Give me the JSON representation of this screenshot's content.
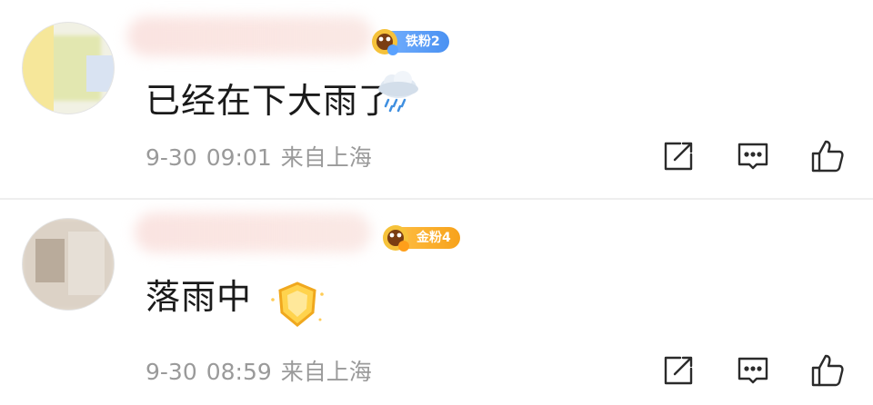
{
  "comments": [
    {
      "fan_badge": "铁粉2",
      "content": "已经在下大雨了",
      "emoji": "rain-cloud-emoji",
      "date": "9-30",
      "time": "09:01",
      "location": "来自上海"
    },
    {
      "fan_badge": "金粉4",
      "content": "落雨中",
      "emoji": "gold-shield-emoji",
      "date": "9-30",
      "time": "08:59",
      "location": "来自上海"
    }
  ],
  "colors": {
    "meta_text": "#9a9a9a",
    "iron_fan_badge": "#4a91f2",
    "gold_fan_badge": "#f7a21b",
    "icon_stroke": "#2b2b2b"
  }
}
